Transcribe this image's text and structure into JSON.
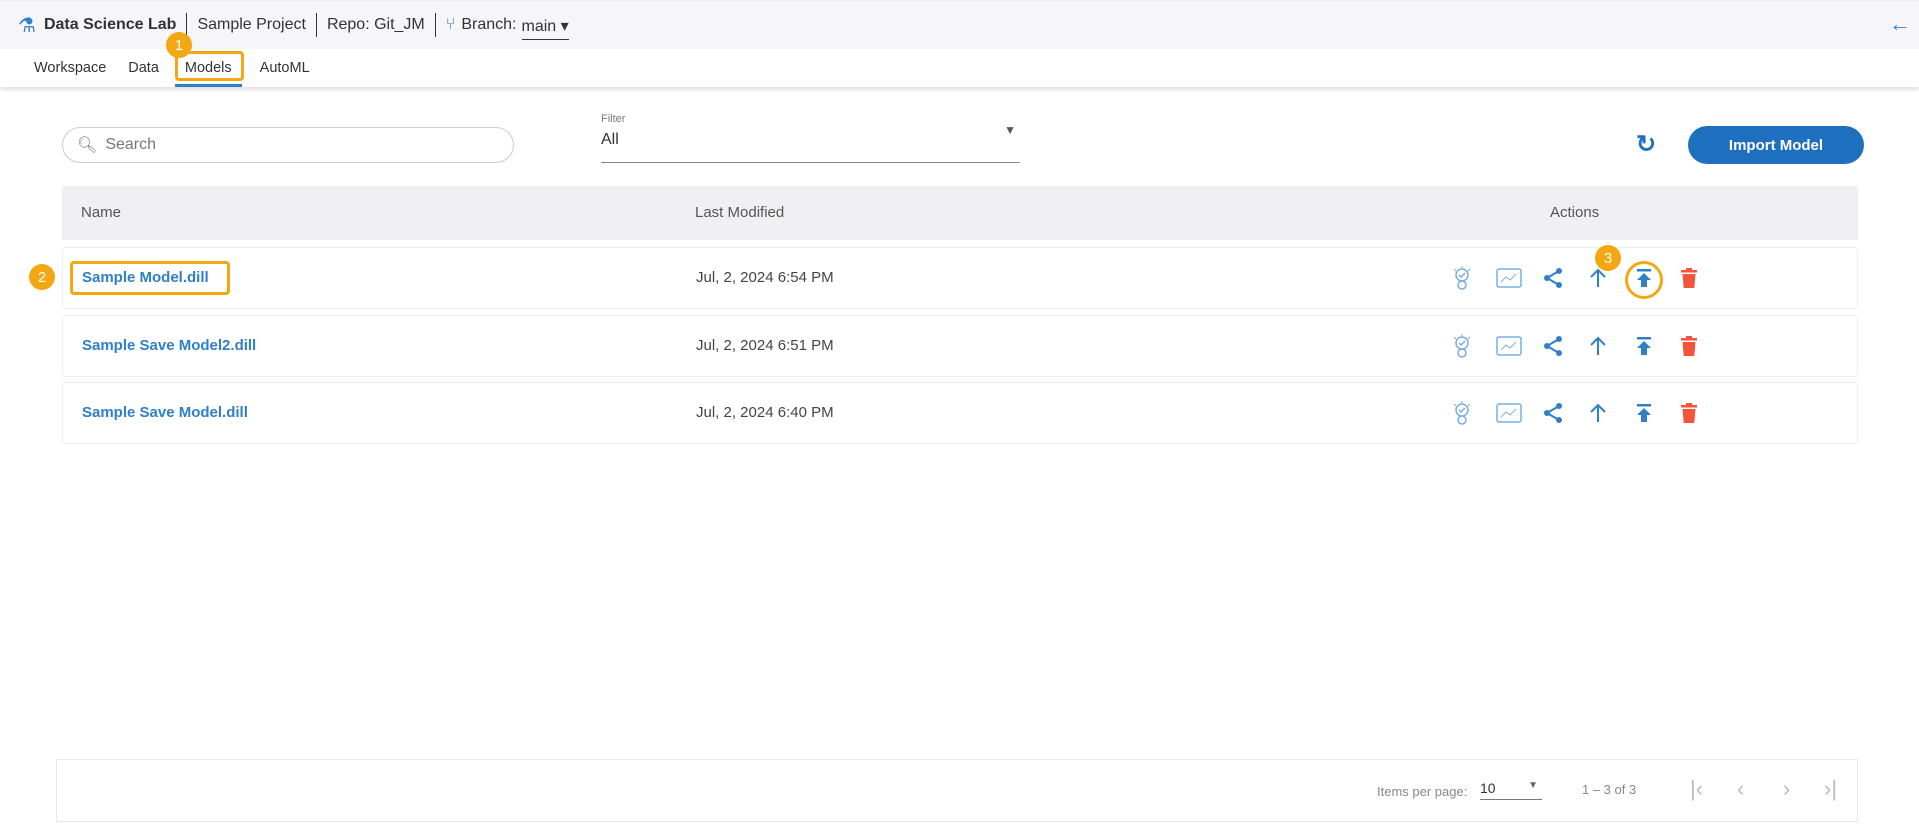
{
  "header": {
    "app_title": "Data Science Lab",
    "project": "Sample Project",
    "repo": "Repo: Git_JM",
    "branch_label": "Branch:",
    "branch": "main"
  },
  "tabs": [
    {
      "label": "Workspace"
    },
    {
      "label": "Data"
    },
    {
      "label": "Models"
    },
    {
      "label": "AutoML"
    }
  ],
  "toolbar": {
    "search_placeholder": "Search",
    "filter_label": "Filter",
    "filter_value": "All",
    "import_label": "Import Model"
  },
  "table": {
    "headers": [
      "Name",
      "Last Modified",
      "Actions"
    ],
    "rows": [
      {
        "name": "Sample Model.dill",
        "modified": "Jul, 2, 2024 6:54 PM"
      },
      {
        "name": "Sample Save Model2.dill",
        "modified": "Jul, 2, 2024 6:51 PM"
      },
      {
        "name": "Sample Save Model.dill",
        "modified": "Jul, 2, 2024 6:40 PM"
      }
    ]
  },
  "pagination": {
    "items_per_page_label": "Items per page:",
    "items_per_page": "10",
    "range": "1 – 3 of 3"
  },
  "annotations": [
    "1",
    "2",
    "3"
  ],
  "colors": {
    "accent": "#2f80c9",
    "button": "#1f6fc0",
    "delete": "#f2553a",
    "annotation": "#f3a712"
  }
}
